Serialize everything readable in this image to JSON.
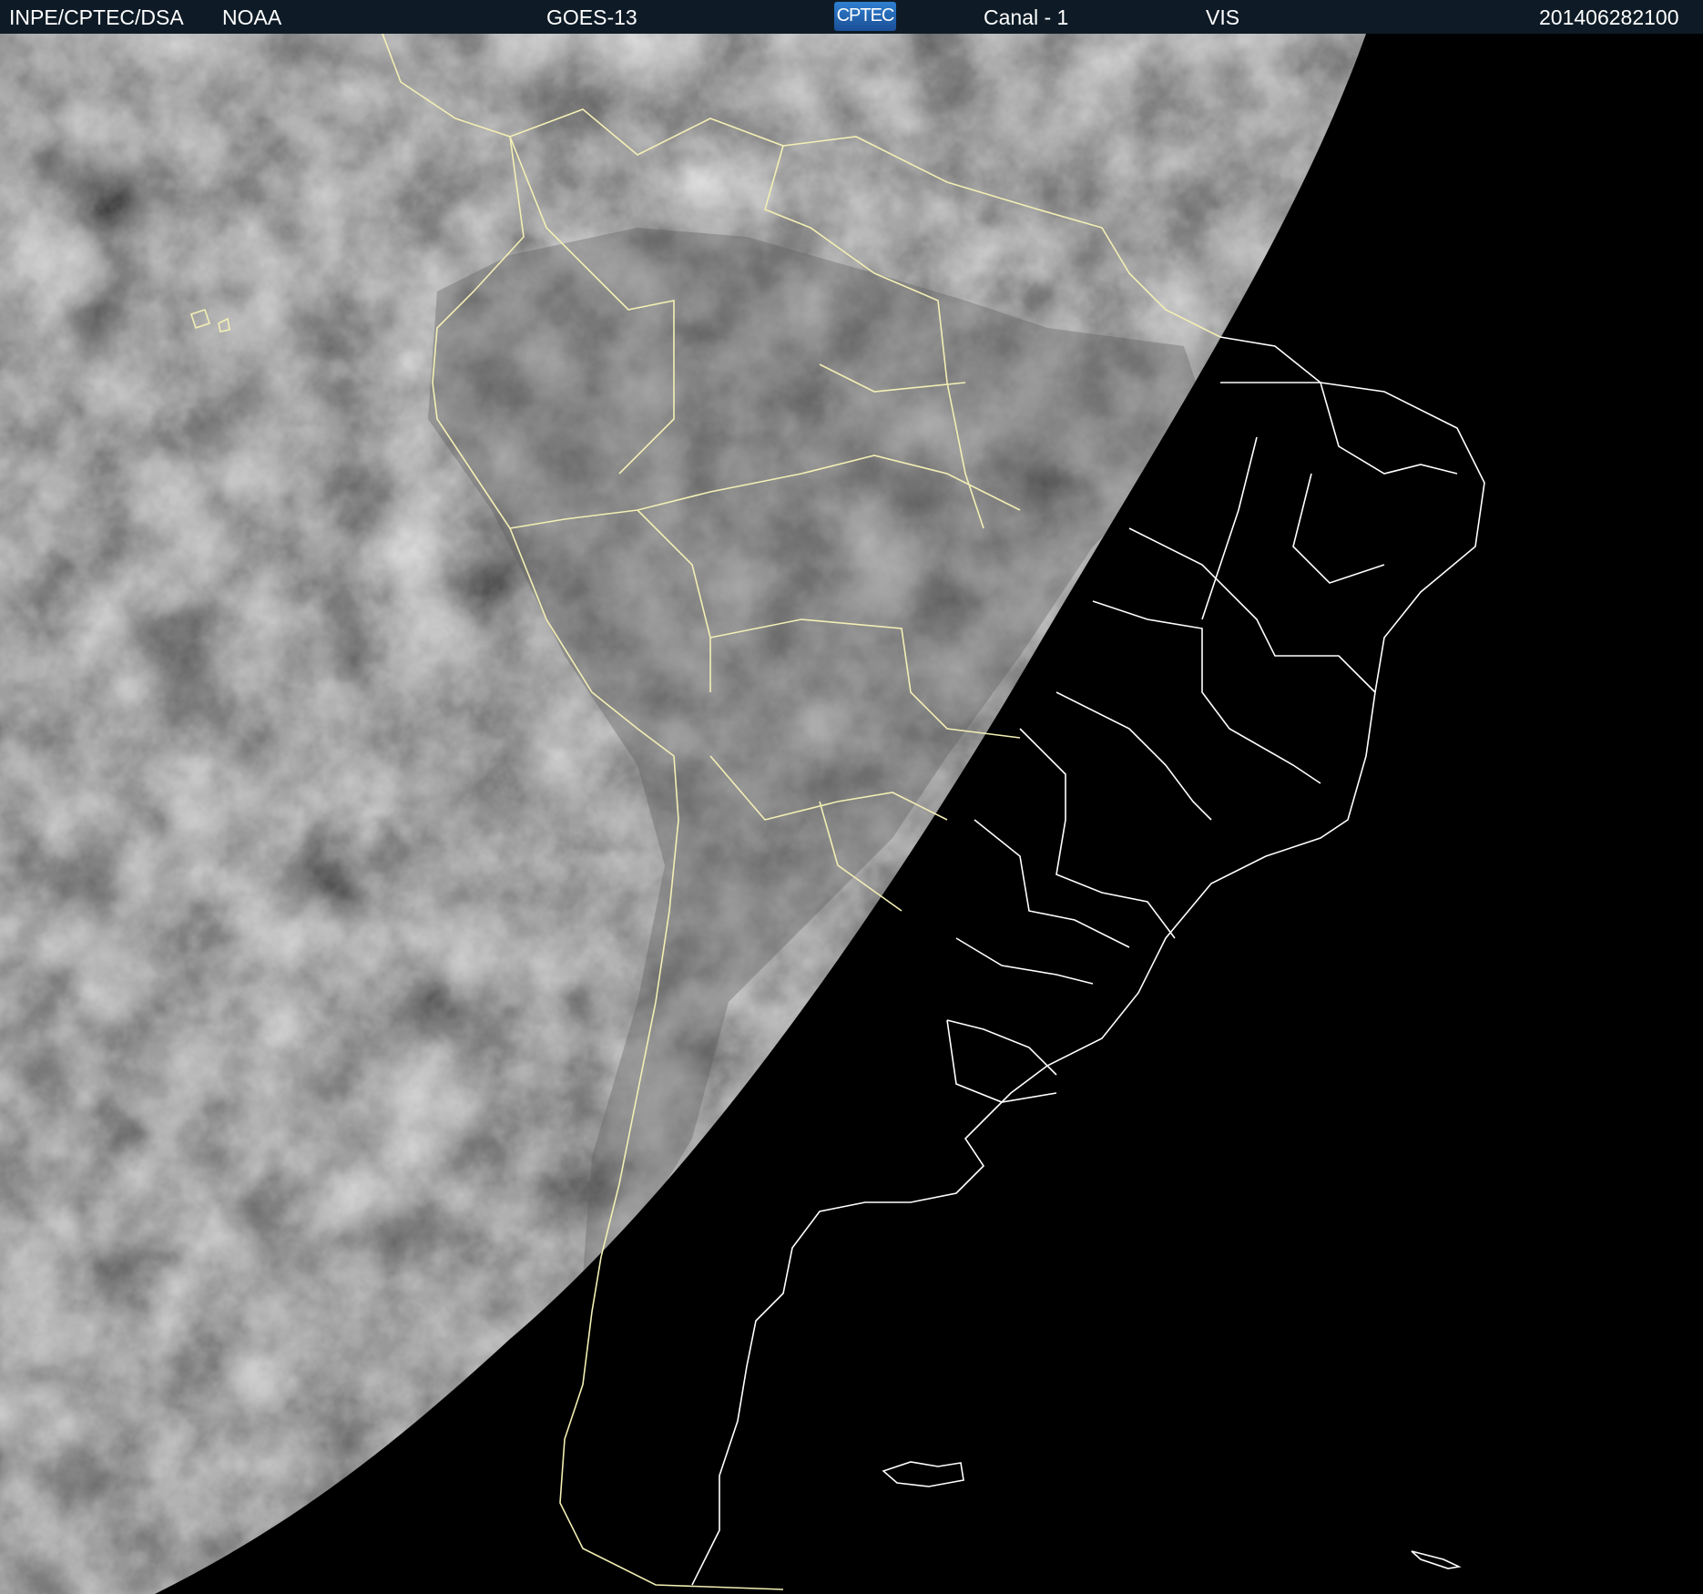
{
  "header": {
    "agency": "INPE/CPTEC/DSA",
    "provider": "NOAA",
    "satellite": "GOES-13",
    "logo_text": "CPTEC",
    "channel": "Canal - 1",
    "band": "VIS",
    "timestamp": "201406282100"
  },
  "colors": {
    "header_bg": "#0e1b26",
    "daylit_clouds": "#b9b9b9",
    "night_side": "#000000",
    "lit_borders": "#f3efb4",
    "night_borders": "#ffffff"
  }
}
